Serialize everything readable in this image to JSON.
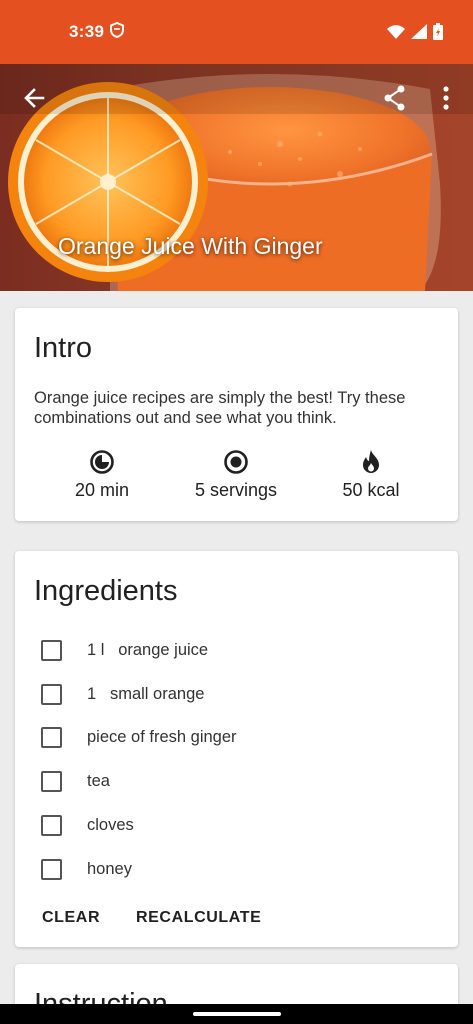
{
  "status_bar": {
    "time": "3:39",
    "icons": [
      "shield-icon",
      "wifi-icon",
      "signal-icon",
      "battery-icon"
    ],
    "color": "#e4501f"
  },
  "header": {
    "title": "Orange Juice With Ginger",
    "icons": [
      "back-arrow-icon",
      "share-icon",
      "more-vert-icon"
    ]
  },
  "intro": {
    "title": "Intro",
    "description": "Orange juice recipes are simply the best! Try these combinations out and see what you think.",
    "stats": [
      {
        "icon": "timer-icon",
        "value": "20 min"
      },
      {
        "icon": "servings-icon",
        "value": "5 servings"
      },
      {
        "icon": "fire-icon",
        "value": "50 kcal"
      }
    ]
  },
  "ingredients": {
    "title": "Ingredients",
    "items": [
      {
        "qty": "1 l",
        "name": "orange juice",
        "checked": false
      },
      {
        "qty": "1",
        "name": "small orange",
        "checked": false
      },
      {
        "qty": "",
        "name": "piece of fresh ginger",
        "checked": false
      },
      {
        "qty": "",
        "name": "tea",
        "checked": false
      },
      {
        "qty": "",
        "name": "cloves",
        "checked": false
      },
      {
        "qty": "",
        "name": "honey",
        "checked": false
      }
    ],
    "clear_label": "CLEAR",
    "recalculate_label": "RECALCULATE"
  },
  "instruction": {
    "title": "Instruction"
  }
}
